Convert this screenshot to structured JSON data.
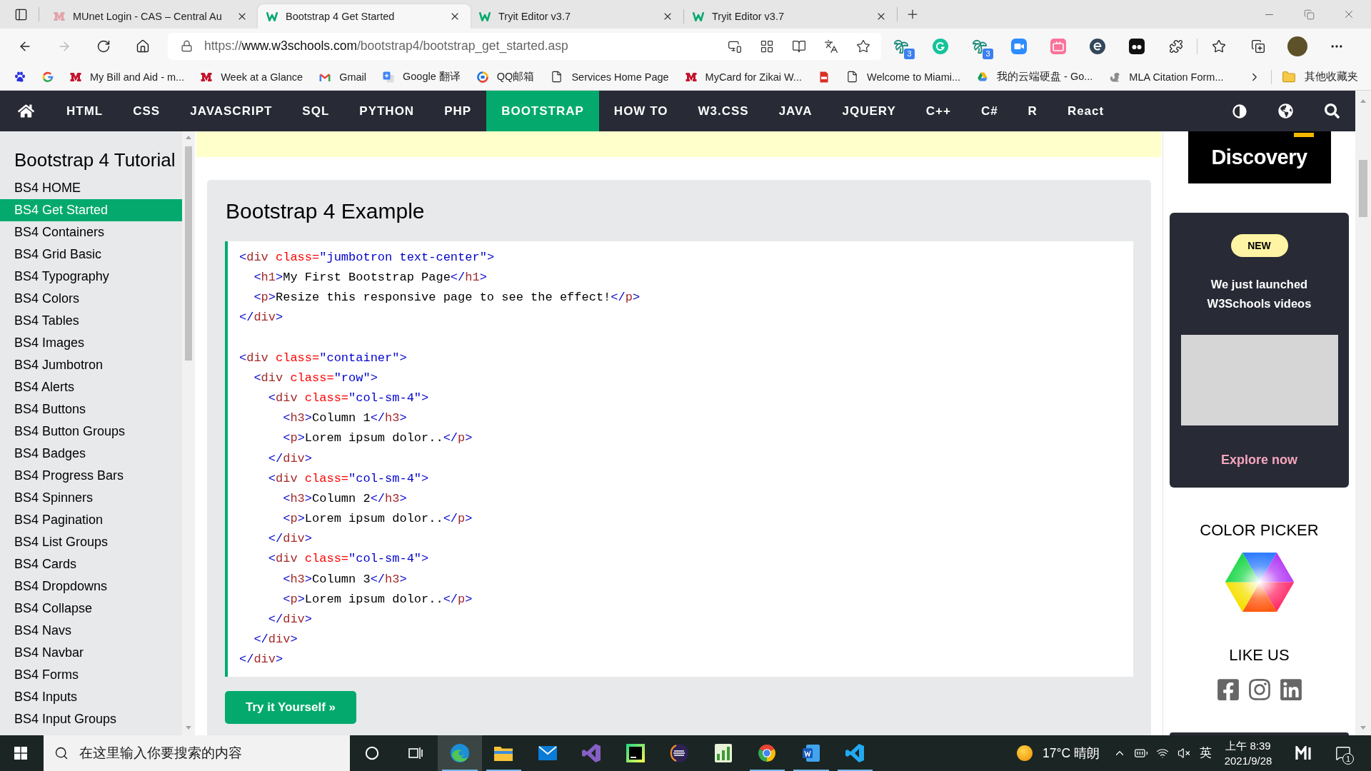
{
  "browser": {
    "tabs": [
      {
        "kind": "m-faded",
        "title": "MUnet Login - CAS – Central Au",
        "selected": false
      },
      {
        "kind": "w3",
        "title": "Bootstrap 4 Get Started",
        "selected": true
      },
      {
        "kind": "w3",
        "title": "Tryit Editor v3.7",
        "selected": false
      },
      {
        "kind": "w3",
        "title": "Tryit Editor v3.7",
        "selected": false
      }
    ],
    "nav_buttons": [
      {
        "kind": "back",
        "disabled": false
      },
      {
        "kind": "forward",
        "disabled": true
      },
      {
        "kind": "reload",
        "disabled": false
      },
      {
        "kind": "home",
        "disabled": false
      }
    ],
    "address": {
      "scheme": "https://",
      "host": "www.w3schools.com",
      "path": "/bootstrap4/bootstrap_get_started.asp"
    },
    "extensions": [
      {
        "kind": "palm",
        "badge": "3"
      },
      {
        "kind": "grammar"
      },
      {
        "kind": "palm",
        "badge": "3"
      },
      {
        "kind": "camera"
      },
      {
        "kind": "tv"
      },
      {
        "kind": "e-circle"
      },
      {
        "kind": "dots"
      },
      {
        "kind": "puzzle"
      }
    ],
    "bookmarks": [
      {
        "kind": "paw"
      },
      {
        "kind": "google"
      },
      {
        "kind": "m-logo",
        "label": "My Bill and Aid - m..."
      },
      {
        "kind": "m-logo",
        "label": "Week at a Glance"
      },
      {
        "kind": "mail",
        "label": "Gmail"
      },
      {
        "kind": "translate",
        "label": "Google 翻译"
      },
      {
        "kind": "qq",
        "label": "QQ邮箱"
      },
      {
        "kind": "page",
        "label": "Services Home Page"
      },
      {
        "kind": "m-logo",
        "label": "MyCard for Zikai W..."
      },
      {
        "kind": "pdf"
      },
      {
        "kind": "page",
        "label": "Welcome to Miami..."
      },
      {
        "kind": "drive",
        "label": "我的云端硬盘 - Go..."
      },
      {
        "kind": "squirrel",
        "label": "MLA Citation Form..."
      }
    ],
    "other_bookmarks": "其他收藏夹"
  },
  "site_nav": {
    "items": [
      {
        "label": "HTML",
        "selected": false
      },
      {
        "label": "CSS",
        "selected": false
      },
      {
        "label": "JAVASCRIPT",
        "selected": false
      },
      {
        "label": "SQL",
        "selected": false
      },
      {
        "label": "PYTHON",
        "selected": false
      },
      {
        "label": "PHP",
        "selected": false
      },
      {
        "label": "BOOTSTRAP",
        "selected": true
      },
      {
        "label": "HOW TO",
        "selected": false
      },
      {
        "label": "W3.CSS",
        "selected": false
      },
      {
        "label": "JAVA",
        "selected": false
      },
      {
        "label": "JQUERY",
        "selected": false
      },
      {
        "label": "C++",
        "selected": false
      },
      {
        "label": "C#",
        "selected": false
      },
      {
        "label": "R",
        "selected": false
      },
      {
        "label": "React",
        "selected": false
      }
    ]
  },
  "sidebar": {
    "title": "Bootstrap 4 Tutorial",
    "items": [
      {
        "label": "BS4 HOME",
        "selected": false
      },
      {
        "label": "BS4 Get Started",
        "selected": true
      },
      {
        "label": "BS4 Containers",
        "selected": false
      },
      {
        "label": "BS4 Grid Basic",
        "selected": false
      },
      {
        "label": "BS4 Typography",
        "selected": false
      },
      {
        "label": "BS4 Colors",
        "selected": false
      },
      {
        "label": "BS4 Tables",
        "selected": false
      },
      {
        "label": "BS4 Images",
        "selected": false
      },
      {
        "label": "BS4 Jumbotron",
        "selected": false
      },
      {
        "label": "BS4 Alerts",
        "selected": false
      },
      {
        "label": "BS4 Buttons",
        "selected": false
      },
      {
        "label": "BS4 Button Groups",
        "selected": false
      },
      {
        "label": "BS4 Badges",
        "selected": false
      },
      {
        "label": "BS4 Progress Bars",
        "selected": false
      },
      {
        "label": "BS4 Spinners",
        "selected": false
      },
      {
        "label": "BS4 Pagination",
        "selected": false
      },
      {
        "label": "BS4 List Groups",
        "selected": false
      },
      {
        "label": "BS4 Cards",
        "selected": false
      },
      {
        "label": "BS4 Dropdowns",
        "selected": false
      },
      {
        "label": "BS4 Collapse",
        "selected": false
      },
      {
        "label": "BS4 Navs",
        "selected": false
      },
      {
        "label": "BS4 Navbar",
        "selected": false
      },
      {
        "label": "BS4 Forms",
        "selected": false
      },
      {
        "label": "BS4 Inputs",
        "selected": false
      },
      {
        "label": "BS4 Input Groups",
        "selected": false
      }
    ]
  },
  "example": {
    "heading": "Bootstrap 4 Example",
    "code": "<div class=\"jumbotron text-center\">\n  <h1>My First Bootstrap Page</h1>\n  <p>Resize this responsive page to see the effect!</p>\n</div>\n\n<div class=\"container\">\n  <div class=\"row\">\n    <div class=\"col-sm-4\">\n      <h3>Column 1</h3>\n      <p>Lorem ipsum dolor..</p>\n    </div>\n    <div class=\"col-sm-4\">\n      <h3>Column 2</h3>\n      <p>Lorem ipsum dolor..</p>\n    </div>\n    <div class=\"col-sm-4\">\n      <h3>Column 3</h3>\n      <p>Lorem ipsum dolor..</p>\n    </div>\n  </div>\n</div>",
    "button": "Try it Yourself »"
  },
  "right_column": {
    "ad_logo": "Discovery",
    "promo": {
      "badge": "NEW",
      "text": "We just launched W3Schools videos",
      "link": "Explore now"
    },
    "color_picker_title": "COLOR PICKER",
    "like_us_title": "LIKE US",
    "socials": [
      {
        "kind": "facebook"
      },
      {
        "kind": "instagram"
      },
      {
        "kind": "linkedin"
      }
    ]
  },
  "taskbar": {
    "search": {
      "placeholder": "在这里输入你要搜索的内容"
    },
    "apps": [
      {
        "kind": "edge",
        "selected": true,
        "running": true
      },
      {
        "kind": "explorer",
        "selected": false,
        "running": true
      },
      {
        "kind": "mail",
        "selected": false,
        "running": false
      },
      {
        "kind": "vs",
        "selected": false,
        "running": false
      },
      {
        "kind": "pycharm",
        "selected": false,
        "running": false
      },
      {
        "kind": "eclipse",
        "selected": false,
        "running": false
      },
      {
        "kind": "chart",
        "selected": false,
        "running": false
      },
      {
        "kind": "chrome",
        "selected": false,
        "running": true
      },
      {
        "kind": "word",
        "selected": false,
        "running": true
      },
      {
        "kind": "vscode",
        "selected": false,
        "running": true
      }
    ],
    "weather": "17°C 晴朗",
    "input_method": "英",
    "time": "上午 8:39",
    "date": "2021/9/28",
    "notifications": "1"
  }
}
